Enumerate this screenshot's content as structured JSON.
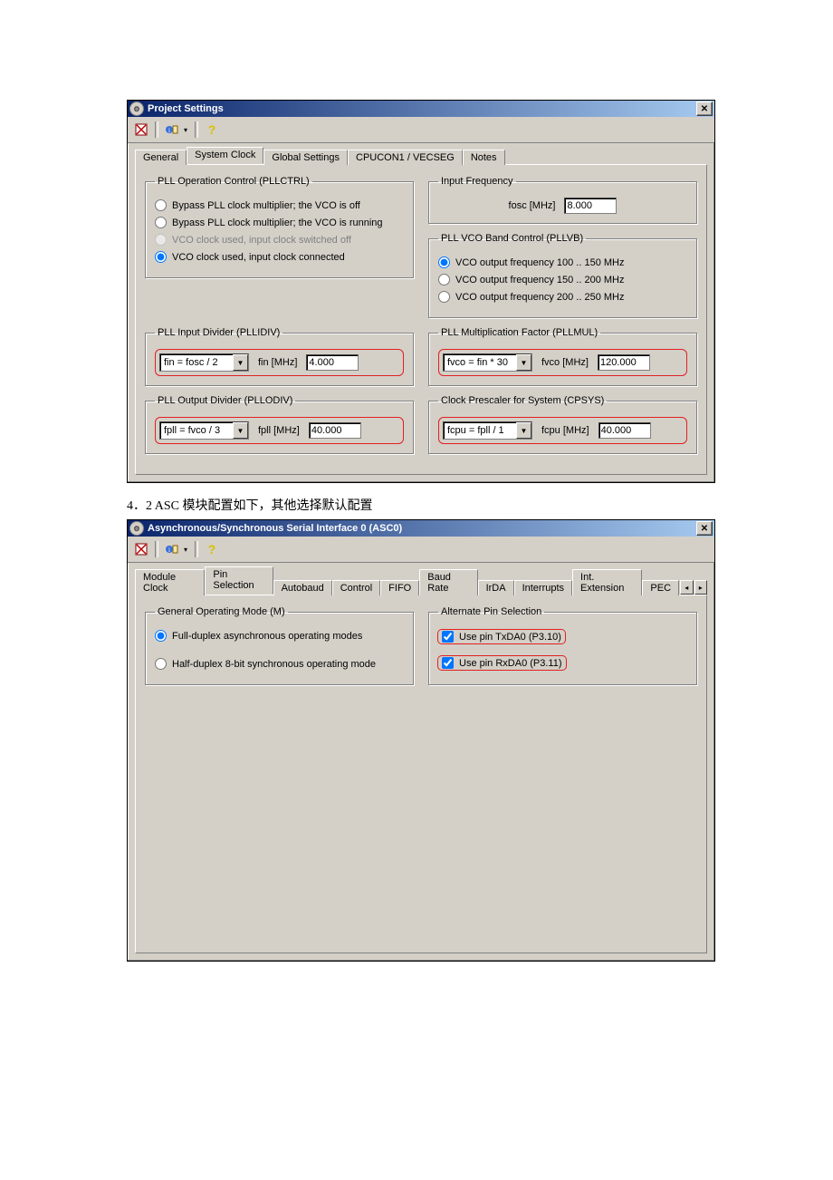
{
  "dialog1": {
    "title": "Project Settings",
    "tabs": [
      "General",
      "System Clock",
      "Global Settings",
      "CPUCON1 / VECSEG",
      "Notes"
    ],
    "active_tab": 1,
    "pllctrl": {
      "legend": "PLL Operation Control (PLLCTRL)",
      "opt0": "Bypass PLL clock multiplier; the VCO is off",
      "opt1": "Bypass PLL clock multiplier; the VCO is running",
      "opt2": "VCO clock used, input clock switched off",
      "opt3": "VCO clock used, input clock connected"
    },
    "inputfreq": {
      "legend": "Input Frequency",
      "label": "fosc [MHz]",
      "value": "8.000"
    },
    "pllvb": {
      "legend": "PLL VCO Band Control (PLLVB)",
      "opt0": "VCO output frequency 100 .. 150 MHz",
      "opt1": "VCO output frequency 150 .. 200 MHz",
      "opt2": "VCO output frequency 200 .. 250 MHz"
    },
    "pllidiv": {
      "legend": "PLL Input Divider (PLLIDIV)",
      "combo": "fin = fosc / 2",
      "label": "fin [MHz]",
      "value": "4.000"
    },
    "pllmul": {
      "legend": "PLL Multiplication Factor (PLLMUL)",
      "combo": "fvco = fin * 30",
      "label": "fvco [MHz]",
      "value": "120.000"
    },
    "pllodiv": {
      "legend": "PLL Output Divider (PLLODIV)",
      "combo": "fpll = fvco / 3",
      "label": "fpll [MHz]",
      "value": "40.000"
    },
    "cpsys": {
      "legend": "Clock Prescaler for System (CPSYS)",
      "combo": "fcpu = fpll / 1",
      "label": "fcpu [MHz]",
      "value": "40.000"
    }
  },
  "caption": "4．2   ASC 模块配置如下，其他选择默认配置",
  "dialog2": {
    "title": "Asynchronous/Synchronous Serial Interface 0 (ASC0)",
    "tabs": [
      "Module Clock",
      "Pin Selection",
      "Autobaud",
      "Control",
      "FIFO",
      "Baud Rate",
      "IrDA",
      "Interrupts",
      "Int. Extension",
      "PEC"
    ],
    "active_tab": 1,
    "gom": {
      "legend": "General Operating Mode (M)",
      "opt0": "Full-duplex asynchronous operating modes",
      "opt1": "Half-duplex 8-bit synchronous operating mode"
    },
    "altpin": {
      "legend": "Alternate Pin Selection",
      "chk0": "Use pin TxDA0 (P3.10)",
      "chk1": "Use pin RxDA0 (P3.11)"
    }
  }
}
